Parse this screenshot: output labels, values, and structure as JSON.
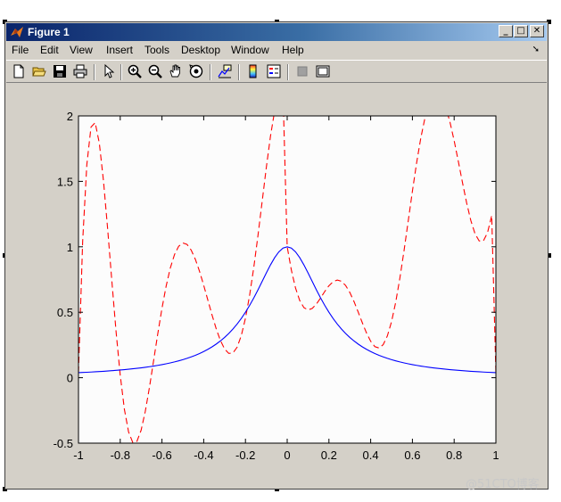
{
  "window": {
    "title": "Figure 1"
  },
  "menu": [
    "File",
    "Edit",
    "View",
    "Insert",
    "Tools",
    "Desktop",
    "Window",
    "Help"
  ],
  "toolbar_icons": [
    "new-figure-icon",
    "open-file-icon",
    "save-icon",
    "print-icon",
    "pointer-icon",
    "zoom-in-icon",
    "zoom-out-icon",
    "pan-hand-icon",
    "rotate-3d-icon",
    "data-cursor-icon",
    "colorbar-icon",
    "legend-icon",
    "hide-plot-tools-icon",
    "show-plot-tools-icon"
  ],
  "watermark": "@51CTO博客",
  "chart_data": {
    "type": "line",
    "title": "",
    "xlabel": "",
    "ylabel": "",
    "xlim": [
      -1,
      1
    ],
    "ylim": [
      -0.5,
      2
    ],
    "xticks": [
      -1,
      -0.8,
      -0.6,
      -0.4,
      -0.2,
      0,
      0.2,
      0.4,
      0.6,
      0.8,
      1
    ],
    "xtick_labels": [
      "-1",
      "-0.8",
      "-0.6",
      "-0.4",
      "-0.2",
      "0",
      "0.2",
      "0.4",
      "0.6",
      "0.8",
      "1"
    ],
    "yticks": [
      -0.5,
      0,
      0.5,
      1,
      1.5,
      2
    ],
    "ytick_labels": [
      "-0.5",
      "0",
      "0.5",
      "1",
      "1.5",
      "2"
    ],
    "grid": false,
    "background": "#fcfcfc",
    "series": [
      {
        "style": "dashed",
        "color": "#ff0000",
        "x": [
          -1,
          -0.98,
          -0.96,
          -0.94,
          -0.92,
          -0.9,
          -0.88,
          -0.86,
          -0.84,
          -0.82,
          -0.8,
          -0.78,
          -0.76,
          -0.74,
          -0.72,
          -0.7,
          -0.68,
          -0.66,
          -0.64,
          -0.62,
          -0.6,
          -0.58,
          -0.56,
          -0.54,
          -0.52,
          -0.5,
          -0.48,
          -0.46,
          -0.44,
          -0.42,
          -0.4,
          -0.38,
          -0.36,
          -0.34,
          -0.32,
          -0.3,
          -0.28,
          -0.26,
          -0.24,
          -0.22,
          -0.2,
          -0.18,
          -0.16,
          -0.14,
          -0.12,
          -0.1,
          -0.08,
          -0.06,
          -0.04,
          -0.02,
          0,
          0.02,
          0.04,
          0.06,
          0.08,
          0.1,
          0.12,
          0.14,
          0.16,
          0.18,
          0.2,
          0.22,
          0.24,
          0.26,
          0.28,
          0.3,
          0.32,
          0.34,
          0.36,
          0.38,
          0.4,
          0.42,
          0.44,
          0.46,
          0.48,
          0.5,
          0.52,
          0.54,
          0.56,
          0.58,
          0.6,
          0.62,
          0.64,
          0.66,
          0.68,
          0.7,
          0.72,
          0.74,
          0.76,
          0.78,
          0.8,
          0.82,
          0.84,
          0.86,
          0.88,
          0.9,
          0.92,
          0.94,
          0.96,
          0.98,
          1
        ],
        "y": [
          0.038,
          1.0425,
          1.6281,
          1.9152,
          1.9486,
          1.7904,
          1.4998,
          1.1317,
          0.7355,
          0.3533,
          0.0192,
          -0.2419,
          -0.4147,
          -0.4946,
          -0.4864,
          -0.4018,
          -0.2578,
          -0.0738,
          0.1307,
          0.3365,
          0.5299,
          0.6998,
          0.8383,
          0.9405,
          1.0042,
          1.0294,
          1.0184,
          0.975,
          0.9043,
          0.8124,
          0.7059,
          0.592,
          0.4784,
          0.3733,
          0.2845,
          0.2197,
          0.1858,
          0.1887,
          0.2328,
          0.321,
          0.454,
          0.6298,
          0.8434,
          1.0862,
          1.3458,
          1.606,
          1.8458,
          2.0396,
          2.1595,
          2.177,
          1.0,
          0.8221,
          0.6849,
          0.5899,
          0.5356,
          0.5176,
          0.5295,
          0.5631,
          0.6092,
          0.6588,
          0.7027,
          0.7337,
          0.7461,
          0.7367,
          0.7046,
          0.6518,
          0.5824,
          0.5024,
          0.4196,
          0.3419,
          0.2783,
          0.2374,
          0.2267,
          0.2527,
          0.3193,
          0.4281,
          0.5773,
          0.7615,
          0.9722,
          1.1977,
          1.4249,
          1.6397,
          1.8296,
          1.9841,
          2.0958,
          2.1599,
          2.1748,
          2.1419,
          2.0654,
          1.9521,
          1.811,
          1.6529,
          1.4898,
          1.3345,
          1.2003,
          1.0998,
          1.0448,
          1.0452,
          1.1085,
          1.2389,
          0.038
        ]
      },
      {
        "style": "solid",
        "color": "#0000ff",
        "x": [
          -1,
          -0.98,
          -0.96,
          -0.94,
          -0.92,
          -0.9,
          -0.88,
          -0.86,
          -0.84,
          -0.82,
          -0.8,
          -0.78,
          -0.76,
          -0.74,
          -0.72,
          -0.7,
          -0.68,
          -0.66,
          -0.64,
          -0.62,
          -0.6,
          -0.58,
          -0.56,
          -0.54,
          -0.52,
          -0.5,
          -0.48,
          -0.46,
          -0.44,
          -0.42,
          -0.4,
          -0.38,
          -0.36,
          -0.34,
          -0.32,
          -0.3,
          -0.28,
          -0.26,
          -0.24,
          -0.22,
          -0.2,
          -0.18,
          -0.16,
          -0.14,
          -0.12,
          -0.1,
          -0.08,
          -0.06,
          -0.04,
          -0.02,
          0,
          0.02,
          0.04,
          0.06,
          0.08,
          0.1,
          0.12,
          0.14,
          0.16,
          0.18,
          0.2,
          0.22,
          0.24,
          0.26,
          0.28,
          0.3,
          0.32,
          0.34,
          0.36,
          0.38,
          0.4,
          0.42,
          0.44,
          0.46,
          0.48,
          0.5,
          0.52,
          0.54,
          0.56,
          0.58,
          0.6,
          0.62,
          0.64,
          0.66,
          0.68,
          0.7,
          0.72,
          0.74,
          0.76,
          0.78,
          0.8,
          0.82,
          0.84,
          0.86,
          0.88,
          0.9,
          0.92,
          0.94,
          0.96,
          0.98,
          1
        ],
        "y": [
          0.0385,
          0.04,
          0.0416,
          0.0433,
          0.0451,
          0.0471,
          0.0491,
          0.0513,
          0.0536,
          0.0561,
          0.0588,
          0.0617,
          0.0648,
          0.0681,
          0.0716,
          0.0755,
          0.0796,
          0.0841,
          0.089,
          0.0943,
          0.1,
          0.1063,
          0.1131,
          0.1206,
          0.1288,
          0.1379,
          0.1479,
          0.159,
          0.1712,
          0.1848,
          0.2,
          0.2169,
          0.2358,
          0.257,
          0.2809,
          0.3077,
          0.3378,
          0.3717,
          0.4098,
          0.4525,
          0.5,
          0.5525,
          0.6098,
          0.6711,
          0.7353,
          0.8,
          0.8621,
          0.9174,
          0.9615,
          0.9901,
          1.0,
          0.9901,
          0.9615,
          0.9174,
          0.8621,
          0.8,
          0.7353,
          0.6711,
          0.6098,
          0.5525,
          0.5,
          0.4525,
          0.4098,
          0.3717,
          0.3378,
          0.3077,
          0.2809,
          0.257,
          0.2358,
          0.2169,
          0.2,
          0.1848,
          0.1712,
          0.159,
          0.1479,
          0.1379,
          0.1288,
          0.1206,
          0.1131,
          0.1063,
          0.1,
          0.0943,
          0.089,
          0.0841,
          0.0796,
          0.0755,
          0.0716,
          0.0681,
          0.0648,
          0.0617,
          0.0588,
          0.0561,
          0.0536,
          0.0513,
          0.0491,
          0.0471,
          0.0451,
          0.0433,
          0.0416,
          0.04,
          0.0385
        ]
      }
    ]
  }
}
